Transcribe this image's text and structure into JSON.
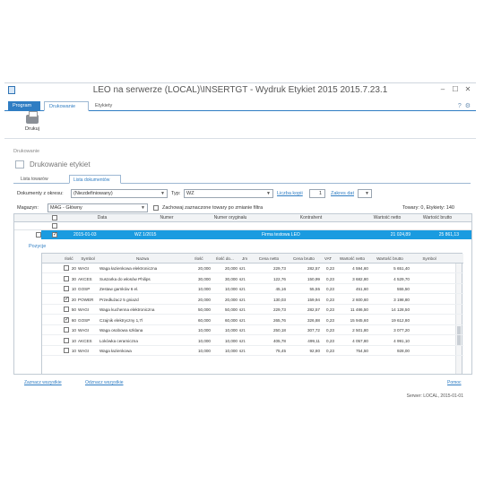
{
  "window": {
    "title": "LEO na serwerze (LOCAL)\\INSERTGT - Wydruk Etykiet 2015 2015.7.23.1",
    "controls": [
      "–",
      "☐",
      "✕"
    ]
  },
  "ribbon": {
    "tabs": [
      "Program",
      "Drukowanie",
      "Etykiety"
    ],
    "print_label": "Drukuj"
  },
  "section_label": "Drukowanie",
  "subheader": "Drukowanie etykiet",
  "subtabs": [
    "Lista towarów",
    "Lista dokumentów"
  ],
  "filters": {
    "doc_label": "Dokumenty z okresu:",
    "doc_value": "(Niezdefiniowany)",
    "type_label": "Typ:",
    "type_value": "WZ",
    "copies_link": "Liczba kopii",
    "copies_value": "1",
    "range_link": "Zakres dat",
    "warehouse_label": "Magazyn:",
    "warehouse_value": "MAG - Główny",
    "checkbox_label": "Zachowaj zaznaczone towary po zmianie filtra",
    "summary": "Towary: 0, Etykiety: 140"
  },
  "grid": {
    "headers": [
      "Data",
      "Numer",
      "Numer oryginału",
      "Kontrahent",
      "Wartość netto",
      "Wartość brutto"
    ],
    "selected_row": {
      "date": "2015-01-03",
      "number": "WZ 1/2015",
      "contractor": "Firma testowa LEO",
      "net": "21 024,89",
      "gross": "25 861,13"
    },
    "positions_label": "Pozycje"
  },
  "inner_grid": {
    "headers": [
      "Ilość",
      "Symbol",
      "Nazwa",
      "Ilość",
      "Ilość do...",
      "Jm",
      "Cena netto",
      "Cena brutto",
      "VAT",
      "Wartość netto",
      "Wartość brutto",
      "Symbol"
    ],
    "rows": [
      {
        "lp": "20",
        "sym": "WAGI",
        "name": "Waga łazienkowa elektroniczna",
        "q1": "20,000",
        "q2": "20,000",
        "jm": "szt.",
        "cn": "229,73",
        "cb": "282,57",
        "vat": "0,23",
        "wn": "4 594,60",
        "wb": "5 651,40"
      },
      {
        "lp": "30",
        "sym": "AKCES",
        "name": "Suszarka do włosów Philips",
        "q1": "30,000",
        "q2": "30,000",
        "jm": "szt.",
        "cn": "122,76",
        "cb": "150,99",
        "vat": "0,23",
        "wn": "3 682,80",
        "wb": "4 529,70"
      },
      {
        "lp": "10",
        "sym": "GOSP",
        "name": "Zestaw garnków 6 el.",
        "q1": "10,000",
        "q2": "10,000",
        "jm": "szt.",
        "cn": "45,16",
        "cb": "55,55",
        "vat": "0,23",
        "wn": "451,60",
        "wb": "555,50"
      },
      {
        "lp": "20",
        "sym": "POWER",
        "name": "Przedłużacz 5 gniazd",
        "q1": "20,000",
        "q2": "20,000",
        "jm": "szt.",
        "cn": "130,03",
        "cb": "159,94",
        "vat": "0,23",
        "wn": "2 600,60",
        "wb": "3 198,80"
      },
      {
        "lp": "50",
        "sym": "WAGI",
        "name": "Waga kuchenna elektroniczna",
        "q1": "50,000",
        "q2": "50,000",
        "jm": "szt.",
        "cn": "229,73",
        "cb": "282,57",
        "vat": "0,23",
        "wn": "11 486,50",
        "wb": "14 128,50"
      },
      {
        "lp": "60",
        "sym": "GOSP",
        "name": "Czajnik elektryczny 1,7l",
        "q1": "60,000",
        "q2": "60,000",
        "jm": "szt.",
        "cn": "265,76",
        "cb": "326,88",
        "vat": "0,23",
        "wn": "15 945,60",
        "wb": "19 612,80"
      },
      {
        "lp": "10",
        "sym": "WAGI",
        "name": "Waga osobowa szklana",
        "q1": "10,000",
        "q2": "10,000",
        "jm": "szt.",
        "cn": "250,18",
        "cb": "307,72",
        "vat": "0,23",
        "wn": "2 501,80",
        "wb": "3 077,20"
      },
      {
        "lp": "10",
        "sym": "AKCES",
        "name": "Lokówka ceramiczna",
        "q1": "10,000",
        "q2": "10,000",
        "jm": "szt.",
        "cn": "405,78",
        "cb": "499,11",
        "vat": "0,23",
        "wn": "4 057,80",
        "wb": "4 991,10"
      },
      {
        "lp": "10",
        "sym": "WAGI",
        "name": "Waga łazienkowa",
        "q1": "10,000",
        "q2": "10,000",
        "jm": "szt.",
        "cn": "75,45",
        "cb": "92,80",
        "vat": "0,23",
        "wn": "754,50",
        "wb": "928,00"
      }
    ]
  },
  "bottom": {
    "link1": "Zaznacz wszystkie",
    "link2": "Odznacz wszystkie",
    "help": "Pomoc"
  },
  "status": "Serwer: LOCAL, 2015-01-01"
}
